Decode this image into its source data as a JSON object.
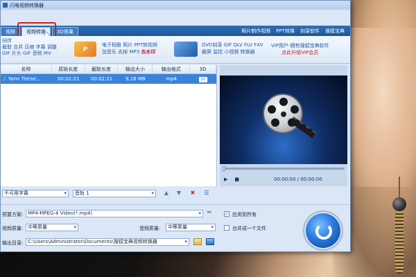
{
  "app": {
    "title": "闪电视频转换器"
  },
  "tabs": [
    {
      "label": "视频",
      "active": false
    },
    {
      "label": "视频转换",
      "active": true
    },
    {
      "label": "3D效果",
      "active": false
    }
  ],
  "top_links": [
    "照片制作视频",
    "PPT转换",
    "刻录软件",
    "搜狐宝典"
  ],
  "toolbar": {
    "lines": [
      "同伴",
      "截取 合并 压缩 字幕 调整",
      "GIF 片头 GIF 音频 MV"
    ],
    "ppt_icon_text": "P",
    "group1": [
      "电子相册 照片 PPT转视频",
      "加音乐 去掉 MP3"
    ],
    "group1_hot": "去水印",
    "group2": [
      "DVD刻录 GIF QLV FLV F4V",
      "截屏 监控 小视频 转换器"
    ],
    "vip_line1": "VIP用户-拥有搜狐宝典软件",
    "vip_line2": "点此升级VIP会员"
  },
  "list": {
    "columns": [
      "名称",
      "原始长度",
      "截取长度",
      "输出大小",
      "输出格式",
      "3D"
    ],
    "rows": [
      {
        "name": "Yann Tierse...",
        "orig": "00:02:21",
        "clip": "00:02:21",
        "size": "9.18 MB",
        "format": "mp4",
        "d3": "3D"
      }
    ]
  },
  "footer": {
    "subtitle": "不可用字幕",
    "audio": "音轨 1"
  },
  "preview": {
    "time": "00:00:00 / 00:00:00",
    "play_icon": "▶",
    "stop_icon": "■"
  },
  "bottom": {
    "preset_label": "预置方案:",
    "preset_value": "MP4-MPEG-4 Video(*.mp4)",
    "apply_all": "应用到所有",
    "video_quality_label": "视频质量:",
    "video_quality_value": "中等质量",
    "audio_quality_label": "音频质量:",
    "audio_quality_value": "中等质量",
    "merge_label": "合并成一个文件",
    "output_label": "输出目录:",
    "output_value": "C:\\Users\\Administrator\\Documents\\搜狐宝典视频转换器"
  },
  "colors": {
    "accent": "#1e66c8",
    "selected_row": "#3b83d8",
    "highlight": "#e01818"
  }
}
